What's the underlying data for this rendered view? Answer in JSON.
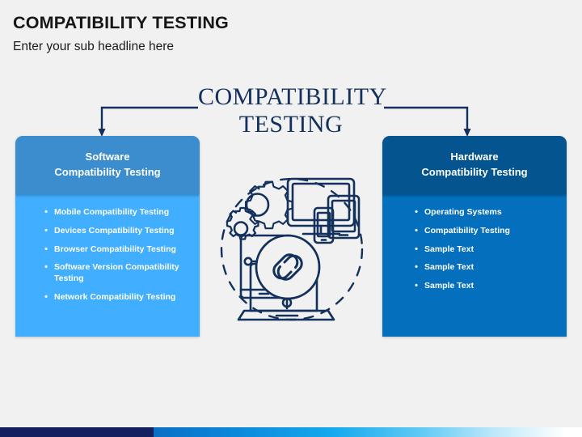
{
  "slide": {
    "background_color": "#f1f1f1",
    "header": {
      "title": "COMPATIBILITY TESTING",
      "subtitle": "Enter your sub headline here"
    },
    "center_title": {
      "line1": "COMPATIBILITY",
      "line2": "TESTING",
      "color": "#13315c"
    },
    "panels": [
      {
        "id": "software",
        "head_line1": "Software",
        "head_line2": "Compatibility Testing",
        "header_color": "#3c8dcd",
        "body_color": "#41aeff",
        "bullet_glyph": "•",
        "bullets": [
          "Mobile Compatibility Testing",
          "Devices Compatibility Testing",
          "Browser Compatibility Testing",
          "Software Version Compatibility Testing",
          "Network Compatibility Testing"
        ]
      },
      {
        "id": "hardware",
        "head_line1": "Hardware",
        "head_line2": "Compatibility Testing",
        "header_color": "#04558f",
        "body_color": "#0470bd",
        "bullet_glyph": "•",
        "bullets": [
          "Operating Systems",
          "Compatibility Testing",
          "Sample Text",
          "Sample Text",
          "Sample Text"
        ]
      }
    ],
    "illustration": {
      "name": "compatibility-devices-illustration",
      "stroke_color": "#13315c",
      "elements": [
        "gears-icon",
        "monitor-icon",
        "tablet-icon",
        "smartphone-icon",
        "laptop-icon",
        "chain-link-icon",
        "dashed-circle"
      ]
    },
    "connectors": {
      "color": "#13315c",
      "left_arrow_label": "connector-to-software-panel",
      "right_arrow_label": "connector-to-hardware-panel"
    },
    "bottom_bar": {
      "navy_color": "#131f5e",
      "gradient_from": "#0a6fc4",
      "gradient_to": "#ffffff"
    }
  }
}
